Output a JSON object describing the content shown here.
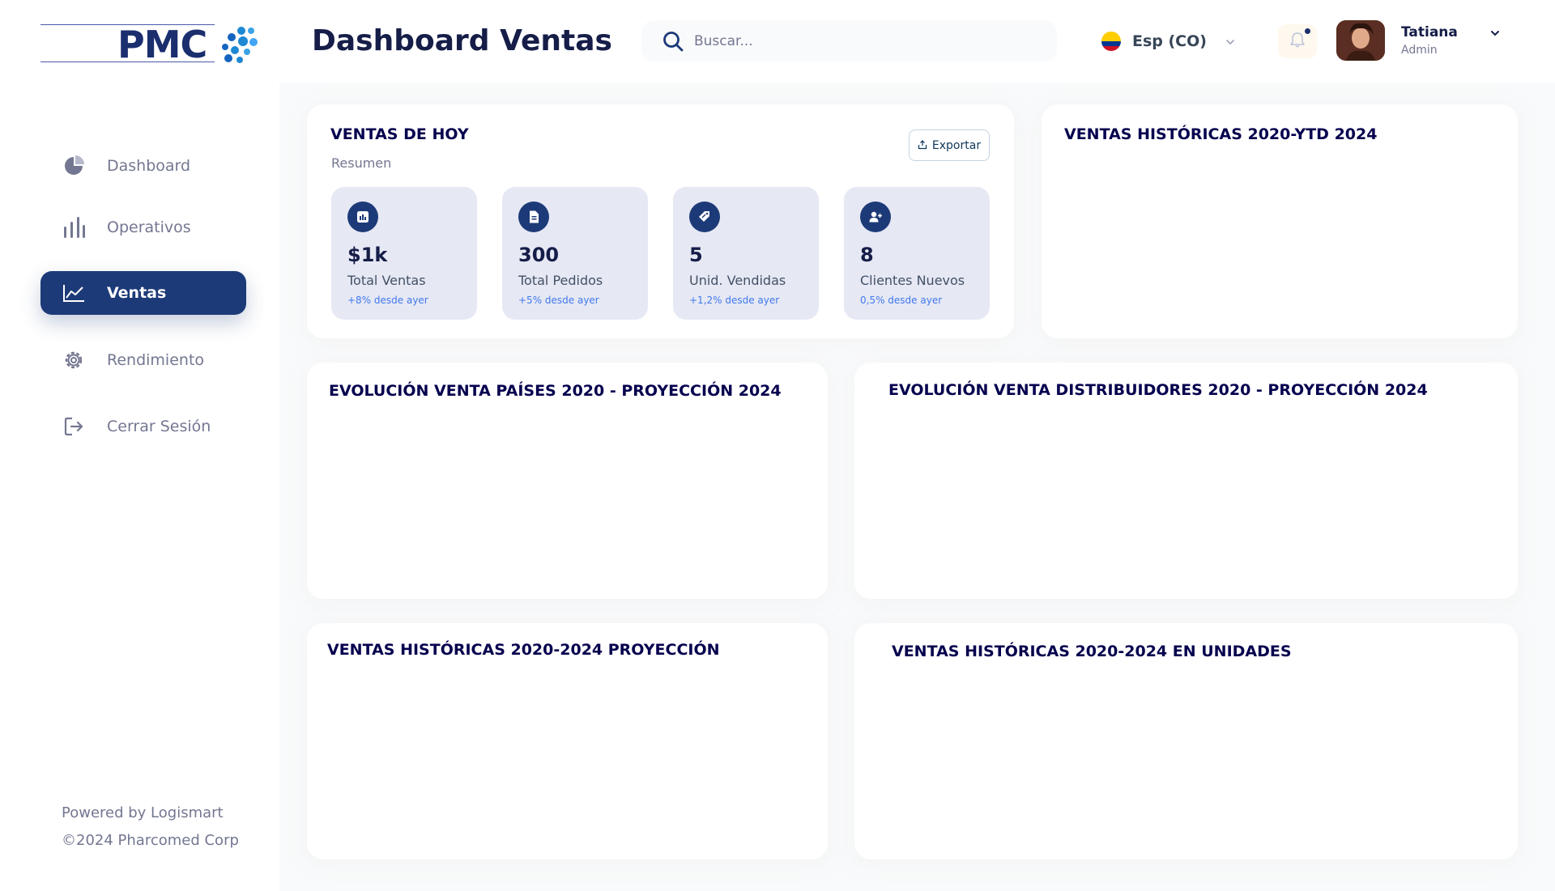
{
  "brand": {
    "logo_text": "PMC"
  },
  "header": {
    "title": "Dashboard Ventas",
    "search_placeholder": "Buscar...",
    "language": "Esp (CO)",
    "user_name": "Tatiana",
    "user_role": "Admin"
  },
  "sidebar": {
    "items": [
      {
        "label": "Dashboard",
        "icon": "pie-chart-icon"
      },
      {
        "label": "Operativos",
        "icon": "bar-chart-icon"
      },
      {
        "label": "Ventas",
        "icon": "line-chart-icon",
        "active": true
      },
      {
        "label": "Rendimiento",
        "icon": "gear-icon"
      },
      {
        "label": "Cerrar Sesión",
        "icon": "logout-icon"
      }
    ],
    "footer_powered": "Powered by Logismart",
    "footer_copyright": "©2024 Pharcomed Corp"
  },
  "today": {
    "title": "VENTAS DE HOY",
    "subtitle": "Resumen",
    "export_label": "Exportar",
    "stats": [
      {
        "value": "$1k",
        "label": "Total Ventas",
        "change": "+8% desde ayer",
        "icon": "chart-icon"
      },
      {
        "value": "300",
        "label": "Total Pedidos",
        "change": "+5% desde ayer",
        "icon": "document-icon"
      },
      {
        "value": "5",
        "label": "Unid. Vendidas",
        "change": "+1,2% desde ayer",
        "icon": "tag-icon"
      },
      {
        "value": "8",
        "label": "Clientes Nuevos",
        "change": "0,5% desde ayer",
        "icon": "add-user-icon"
      }
    ]
  },
  "cards": {
    "historicas_ytd": "VENTAS HISTÓRICAS 2020-YTD 2024",
    "paises": "EVOLUCIÓN VENTA PAÍSES 2020 - PROYECCIÓN 2024",
    "distribuidores": "EVOLUCIÓN VENTA DISTRIBUIDORES 2020 - PROYECCIÓN 2024",
    "proyeccion": "VENTAS HISTÓRICAS 2020-2024 PROYECCIÓN",
    "unidades": "VENTAS HISTÓRICAS 2020-2024 EN UNIDADES"
  },
  "colors": {
    "primary": "#1d3a78",
    "stat_bg": "#e6e8f4",
    "change_text": "#4079ed",
    "page_bg": "#f9fafb"
  }
}
